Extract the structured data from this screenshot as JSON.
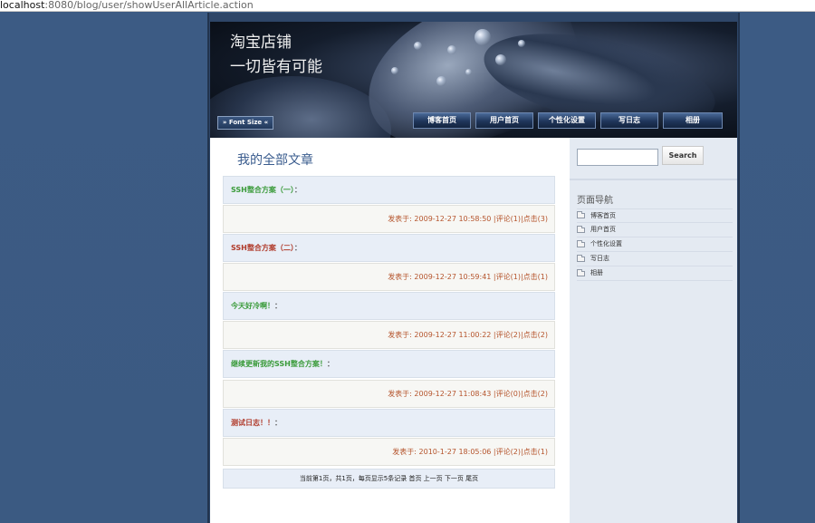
{
  "browser": {
    "url_host": "localhost",
    "url_rest": ":8080/blog/user/showUserAllArticle.action"
  },
  "header": {
    "site_title_line1": "淘宝店铺",
    "site_title_line2": "一切皆有可能",
    "font_size_button": "» Font Size «",
    "nav": [
      "博客首页",
      "用户首页",
      "个性化设置",
      "写日志",
      "相册"
    ]
  },
  "main": {
    "heading": "我的全部文章",
    "articles": [
      {
        "title": "SSH整合方案（一）",
        "title_color": "#3a9b3a",
        "meta": "发表于: 2009-12-27 10:58:50 |评论(1)|点击(3)"
      },
      {
        "title": "SSH整合方案（二）",
        "title_color": "#b03a2a",
        "meta": "发表于: 2009-12-27 10:59:41 |评论(1)|点击(1)"
      },
      {
        "title": "今天好冷啊！",
        "title_color": "#3a9b3a",
        "meta": "发表于: 2009-12-27 11:00:22 |评论(2)|点击(2)"
      },
      {
        "title": "继续更新我的SSH整合方案！",
        "title_color": "#3a9b3a",
        "meta": "发表于: 2009-12-27 11:08:43 |评论(0)|点击(2)"
      },
      {
        "title": "测试日志！！",
        "title_color": "#b03a2a",
        "meta": "发表于: 2010-1-27 18:05:06 |评论(2)|点击(1)"
      }
    ],
    "colon": "：",
    "pager": "当前第1页，共1页，每页显示5条记录 首页 上一页 下一页 尾页"
  },
  "sidebar": {
    "search_placeholder": "",
    "search_button": "Search",
    "nav_heading": "页面导航",
    "nav_items": [
      "博客首页",
      "用户首页",
      "个性化设置",
      "写日志",
      "相册"
    ]
  },
  "colors": {
    "page_bg": "#3b5a82",
    "accent": "#3a5c8e",
    "meta_text": "#b5542c"
  }
}
